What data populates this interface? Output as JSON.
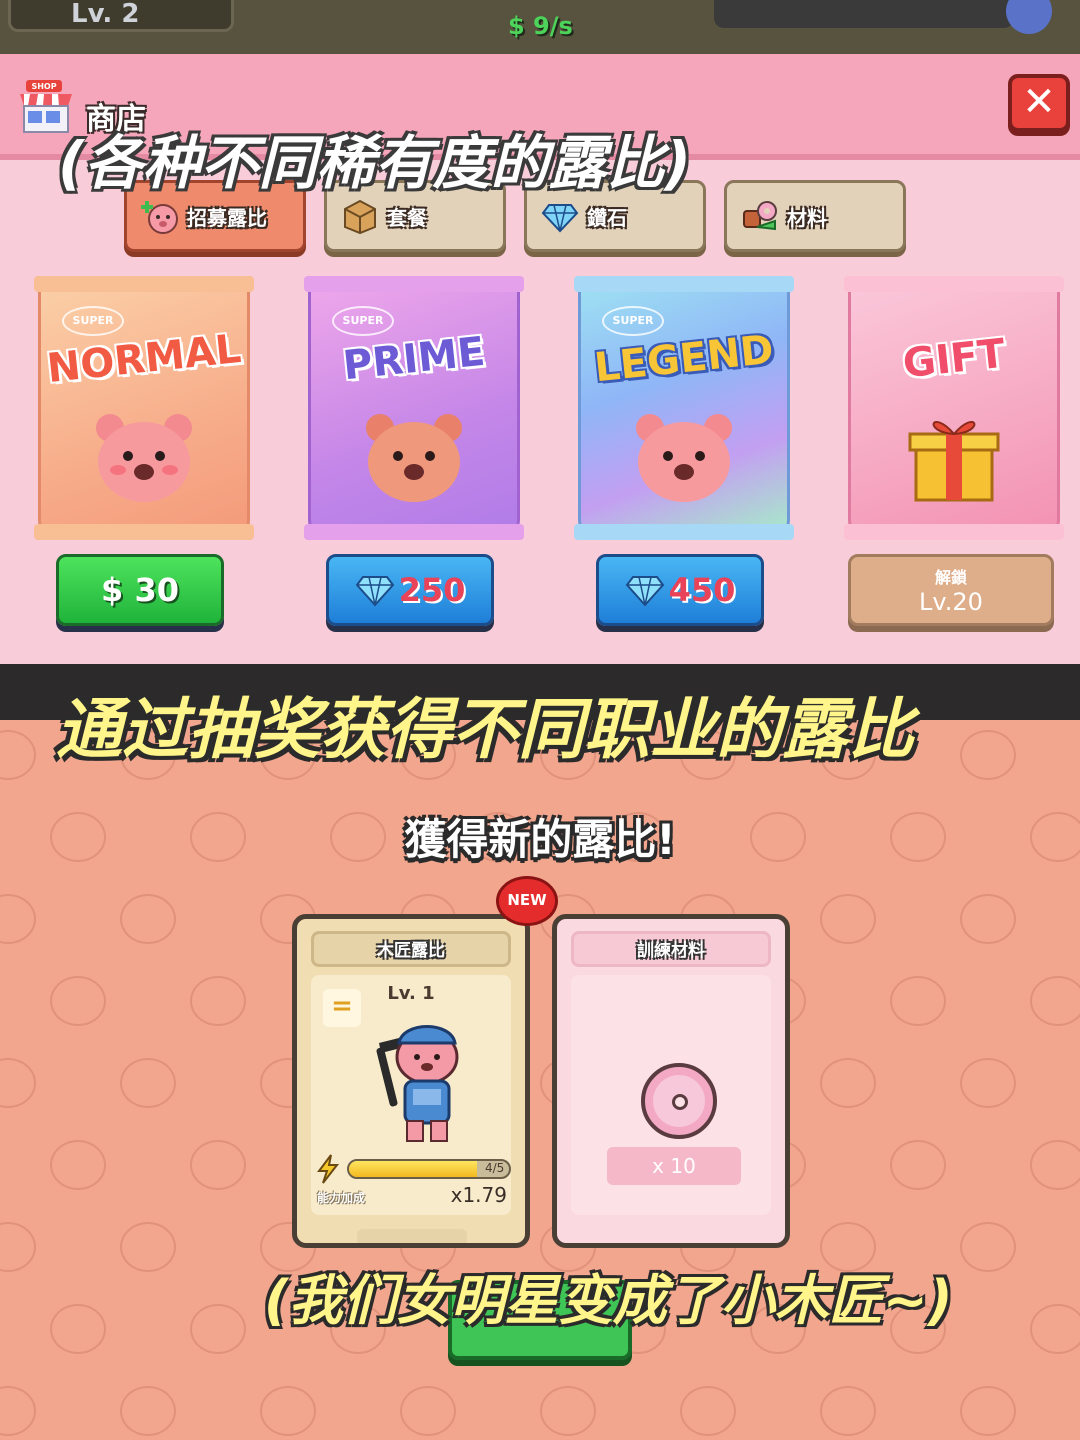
{
  "hud": {
    "player_level": "Lv. 2",
    "income_rate": "$ 9/s"
  },
  "shop": {
    "title": "商店",
    "close_label": "✕",
    "tabs": [
      {
        "label": "招募露比",
        "icon": "quokka-plus-icon",
        "active": true
      },
      {
        "label": "套餐",
        "icon": "box-icon",
        "active": false
      },
      {
        "label": "鑽石",
        "icon": "diamond-icon",
        "active": false
      },
      {
        "label": "材料",
        "icon": "materials-icon",
        "active": false
      }
    ],
    "packs": [
      {
        "super_label": "SUPER",
        "name": "NORMAL",
        "price": "$ 30",
        "currency": "cash"
      },
      {
        "super_label": "SUPER",
        "name": "PRIME",
        "price": "250",
        "currency": "diamond"
      },
      {
        "super_label": "SUPER",
        "name": "LEGEND",
        "price": "450",
        "currency": "diamond"
      },
      {
        "super_label": "",
        "name": "GIFT",
        "locked_label": "解鎖",
        "locked_level": "Lv.20",
        "currency": "locked"
      }
    ]
  },
  "reward": {
    "title": "獲得新的露比!",
    "new_badge": "NEW",
    "character_card": {
      "name": "木匠露比",
      "level": "Lv. 1",
      "rank_symbol": "=",
      "energy_text": "4/5",
      "energy_fraction": 0.8,
      "stat_label": "能力加成",
      "multiplier": "x1.79"
    },
    "material_card": {
      "name": "訓練材料",
      "quantity": "x 10",
      "icon": "donut-icon"
    }
  },
  "captions": {
    "caption_1": "(各种不同稀有度的露比)",
    "caption_2": "通过抽奖获得不同职业的露比",
    "caption_3": "(我们女明星变成了小木匠~)"
  },
  "colors": {
    "shop_bg": "#f9ccd9",
    "header_pink": "#f5a6bb",
    "reward_bg": "#f2a68e",
    "caption_yellow": "#fff58a",
    "green_button": "#20b33b",
    "blue_button": "#1f7fd8"
  }
}
